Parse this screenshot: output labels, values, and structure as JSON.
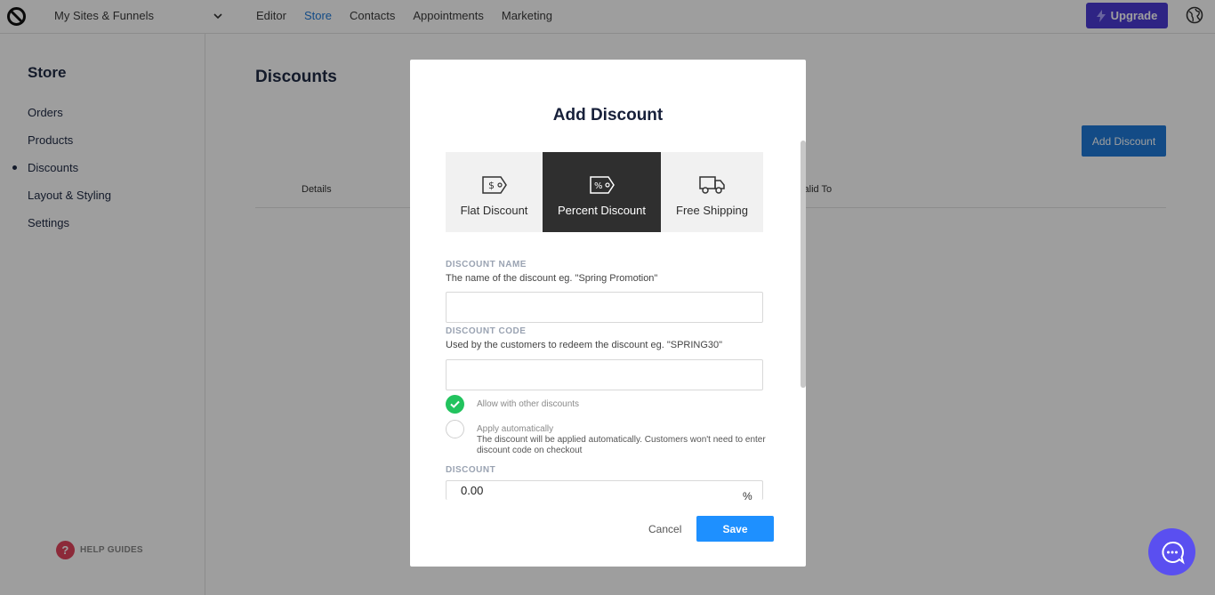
{
  "topbar": {
    "site_switcher": "My Sites & Funnels",
    "nav": [
      "Editor",
      "Store",
      "Contacts",
      "Appointments",
      "Marketing"
    ],
    "active_nav": "Store",
    "upgrade_label": "Upgrade"
  },
  "sidebar": {
    "title": "Store",
    "items": [
      {
        "label": "Orders"
      },
      {
        "label": "Products"
      },
      {
        "label": "Discounts"
      },
      {
        "label": "Layout & Styling"
      },
      {
        "label": "Settings"
      }
    ],
    "active_item": "Discounts",
    "help_label": "HELP GUIDES"
  },
  "main": {
    "title": "Discounts",
    "add_button": "Add Discount",
    "columns": [
      "Details",
      "Valid To"
    ]
  },
  "modal": {
    "title": "Add Discount",
    "tabs": [
      {
        "label": "Flat Discount",
        "icon": "dollar-tag-icon"
      },
      {
        "label": "Percent Discount",
        "icon": "percent-tag-icon"
      },
      {
        "label": "Free Shipping",
        "icon": "truck-icon"
      }
    ],
    "active_tab": "Percent Discount",
    "name_label": "DISCOUNT NAME",
    "name_help": "The name of the discount eg. \"Spring Promotion\"",
    "name_value": "",
    "code_label": "DISCOUNT CODE",
    "code_help": "Used by the customers to redeem the discount eg. \"SPRING30\"",
    "code_value": "",
    "allow_label": "Allow with other discounts",
    "allow_checked": true,
    "auto_label": "Apply automatically",
    "auto_desc": "The discount will be applied automatically. Customers won't need to enter discount code on checkout",
    "auto_checked": false,
    "discount_label": "DISCOUNT",
    "discount_value": "0.00",
    "discount_unit": "%",
    "cancel_label": "Cancel",
    "save_label": "Save"
  },
  "colors": {
    "accent": "#1e90ff",
    "upgrade": "#4b3bd6",
    "active_tab": "#2f2f2f",
    "check_on": "#22c35e",
    "chat": "#5a4ff0"
  }
}
